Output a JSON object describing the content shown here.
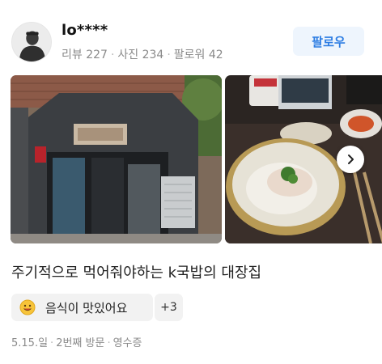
{
  "reviewer": {
    "username": "lo****",
    "stats": {
      "reviews": "리뷰 227",
      "photos": "사진 234",
      "followers": "팔로워 42"
    },
    "follow_label": "팔로우"
  },
  "photos": {
    "items": [
      {
        "description_icon": "restaurant-storefront-photo"
      },
      {
        "description_icon": "gukbap-dish-photo"
      }
    ],
    "next_icon": "chevron-right-icon"
  },
  "review": {
    "text": "주기적으로 먹어줘야하는 k국밥의 대장집",
    "tags": {
      "first_label": "음식이 맛있어요",
      "first_icon": "smiling-face-icon",
      "more_label": "+3"
    },
    "meta": {
      "date": "5.15.일",
      "visit": "2번째 방문",
      "verification": "영수증"
    }
  },
  "colors": {
    "accent": "#2d7de3",
    "follow_bg": "#eef5fd",
    "chip_bg": "#f2f2f2",
    "muted": "#8a8a8a"
  }
}
